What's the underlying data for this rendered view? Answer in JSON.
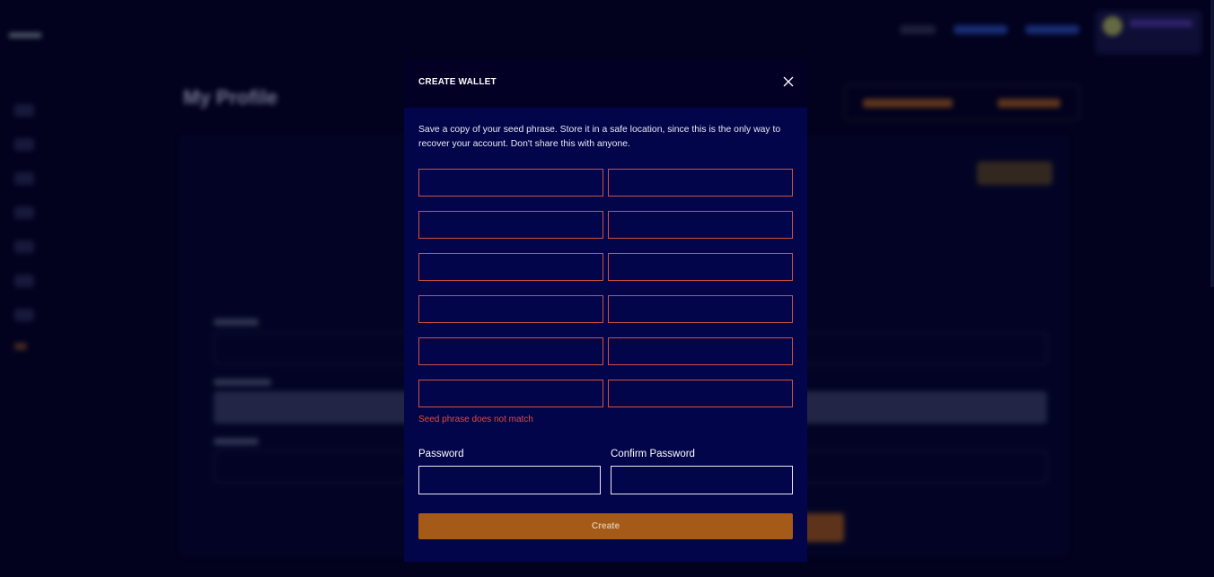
{
  "modal": {
    "title": "CREATE WALLET",
    "close_icon": "close-icon",
    "intro": "Save a copy of your seed phrase. Store it in a safe location, since this is the only way to recover your account. Don't share this with anyone.",
    "seed_words": [
      "",
      "",
      "",
      "",
      "",
      "",
      "",
      "",
      "",
      "",
      "",
      ""
    ],
    "error_text": "Seed phrase does not match",
    "password_label": "Password",
    "confirm_password_label": "Confirm Password",
    "password_value": "",
    "confirm_password_value": "",
    "create_label": "Create"
  },
  "background": {
    "page_title": "My Profile"
  },
  "colors": {
    "modal_header": "#020024",
    "modal_body": "#03054a",
    "error": "#e5483a",
    "seed_border": "#d0503e",
    "button": "#a65a18"
  }
}
